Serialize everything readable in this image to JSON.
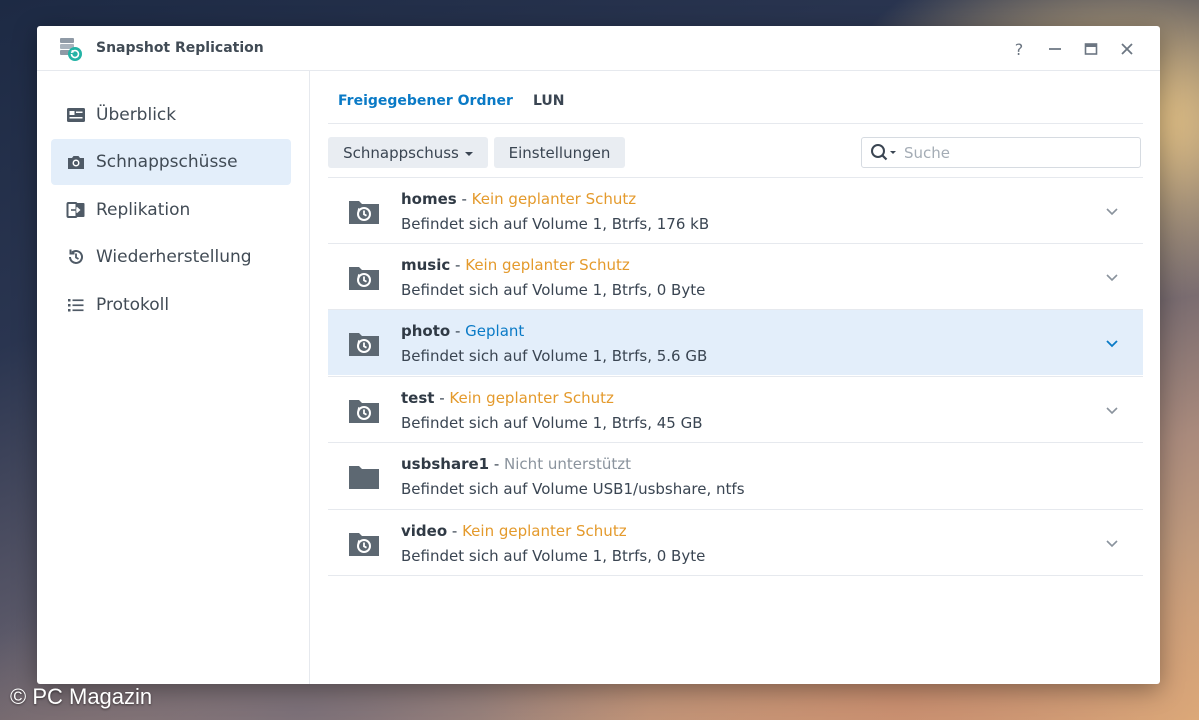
{
  "window": {
    "title": "Snapshot Replication",
    "app_icon": "snapshot-replication-app-icon",
    "controls": {
      "help": "?",
      "minimize": "–",
      "maximize": "□",
      "close": "✕"
    }
  },
  "sidebar": {
    "items": [
      {
        "label": "Überblick",
        "icon": "overview-icon",
        "active": false
      },
      {
        "label": "Schnappschüsse",
        "icon": "camera-icon",
        "active": true
      },
      {
        "label": "Replikation",
        "icon": "replication-icon",
        "active": false
      },
      {
        "label": "Wiederherstellung",
        "icon": "restore-icon",
        "active": false
      },
      {
        "label": "Protokoll",
        "icon": "log-list-icon",
        "active": false
      }
    ]
  },
  "main": {
    "tabs": [
      {
        "label": "Freigegebener Ordner",
        "active": true
      },
      {
        "label": "LUN",
        "active": false
      }
    ],
    "toolbar": {
      "snapshot_label": "Schnappschuss",
      "settings_label": "Einstellungen",
      "search_placeholder": "Suche",
      "search_value": ""
    },
    "folders": [
      {
        "name": "homes",
        "sep": " - ",
        "status": "Kein geplanter Schutz",
        "status_type": "unprotected",
        "location": "Befindet sich auf Volume 1, Btrfs, 176 kB",
        "icon": "snapshot-folder-icon",
        "expandable": true,
        "selected": false
      },
      {
        "name": "music",
        "sep": " - ",
        "status": "Kein geplanter Schutz",
        "status_type": "unprotected",
        "location": "Befindet sich auf Volume 1, Btrfs, 0 Byte",
        "icon": "snapshot-folder-icon",
        "expandable": true,
        "selected": false
      },
      {
        "name": "photo",
        "sep": " - ",
        "status": "Geplant",
        "status_type": "scheduled",
        "location": "Befindet sich auf Volume 1, Btrfs, 5.6 GB",
        "icon": "snapshot-folder-icon",
        "expandable": true,
        "selected": true
      },
      {
        "name": "test",
        "sep": " - ",
        "status": "Kein geplanter Schutz",
        "status_type": "unprotected",
        "location": "Befindet sich auf Volume 1, Btrfs, 45 GB",
        "icon": "snapshot-folder-icon",
        "expandable": true,
        "selected": false
      },
      {
        "name": "usbshare1",
        "sep": " - ",
        "status": "Nicht unterstützt",
        "status_type": "unsupported",
        "location": "Befindet sich auf Volume USB1/usbshare, ntfs",
        "icon": "plain-folder-icon",
        "expandable": false,
        "selected": false
      },
      {
        "name": "video",
        "sep": " - ",
        "status": "Kein geplanter Schutz",
        "status_type": "unprotected",
        "location": "Befindet sich auf Volume 1, Btrfs, 0 Byte",
        "icon": "snapshot-folder-icon",
        "expandable": true,
        "selected": false
      }
    ]
  },
  "colors": {
    "accent": "#0a7ac6",
    "status_unprotected": "#e49a2c",
    "status_unsupported": "#8a939d",
    "selected_bg": "#e3eefa"
  },
  "watermark": "© PC Magazin"
}
